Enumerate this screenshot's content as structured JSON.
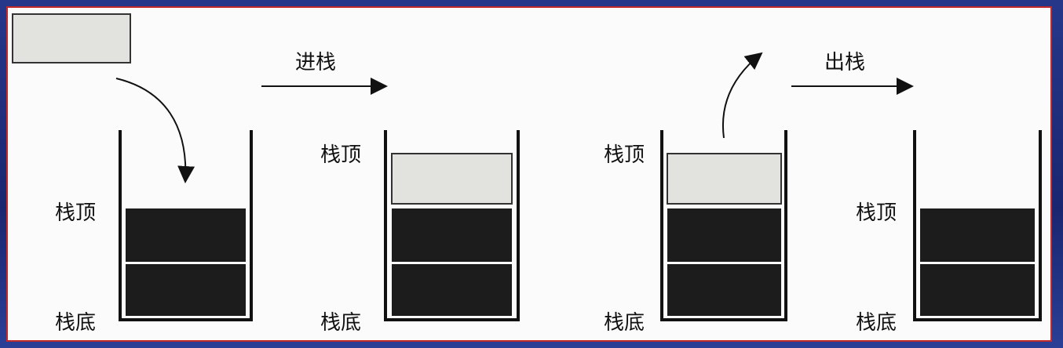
{
  "labels": {
    "push": "进栈",
    "pop": "出栈",
    "stack_top": "栈顶",
    "stack_bottom": "栈底"
  },
  "colors": {
    "block_dark": "#1c1c1c",
    "block_light": "#e2e2df",
    "frame_border": "#c22a2a",
    "background": "#1b2a6b"
  }
}
